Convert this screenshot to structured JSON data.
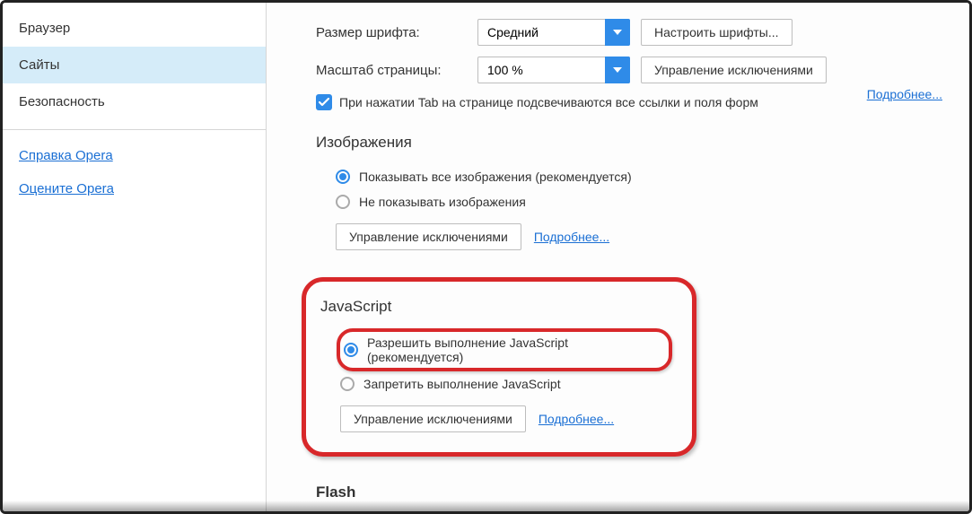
{
  "sidebar": {
    "items": [
      {
        "label": "Браузер"
      },
      {
        "label": "Сайты"
      },
      {
        "label": "Безопасность"
      }
    ],
    "links": [
      {
        "label": "Справка Opera"
      },
      {
        "label": "Оцените Opera"
      }
    ]
  },
  "content": {
    "font_size": {
      "label": "Размер шрифта:",
      "value": "Средний",
      "button": "Настроить шрифты..."
    },
    "page_zoom": {
      "label": "Масштаб страницы:",
      "value": "100 %",
      "button": "Управление исключениями",
      "more_link": "Подробнее..."
    },
    "tab_highlight": {
      "checked": true,
      "label": "При нажатии Tab на странице подсвечиваются все ссылки и поля форм"
    },
    "images": {
      "title": "Изображения",
      "options": [
        "Показывать все изображения (рекомендуется)",
        "Не показывать изображения"
      ],
      "selected": 0,
      "exceptions_button": "Управление исключениями",
      "more_link": "Подробнее..."
    },
    "javascript": {
      "title": "JavaScript",
      "options": [
        "Разрешить выполнение JavaScript (рекомендуется)",
        "Запретить выполнение JavaScript"
      ],
      "selected": 0,
      "exceptions_button": "Управление исключениями",
      "more_link": "Подробнее..."
    },
    "flash": {
      "title": "Flash"
    }
  }
}
